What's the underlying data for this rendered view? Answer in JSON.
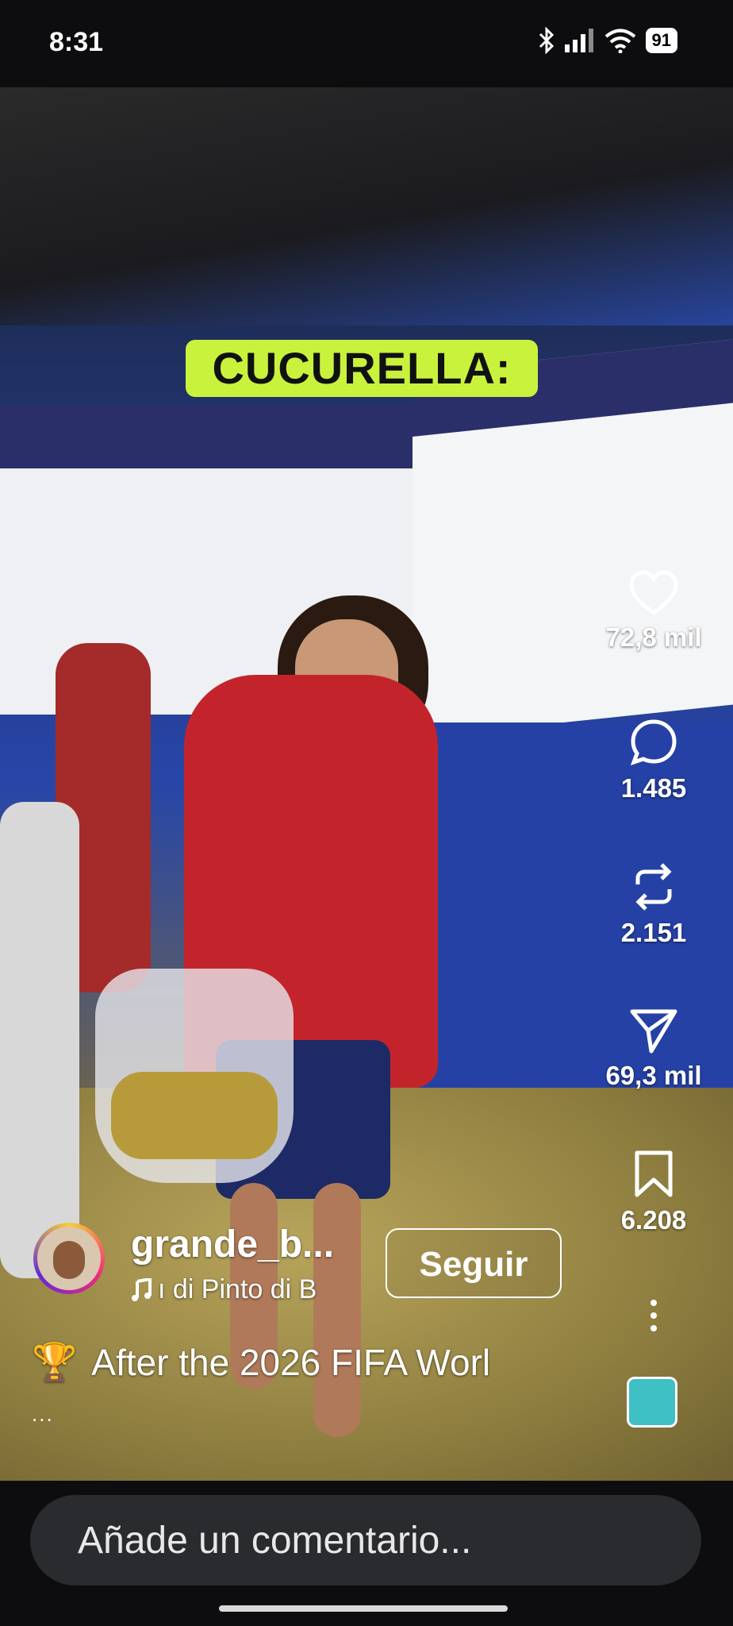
{
  "status_bar": {
    "time": "8:31",
    "battery": "91"
  },
  "video": {
    "overlay_caption": "CUCURELLA:"
  },
  "actions": {
    "likes": "72,8 mil",
    "comments": "1.485",
    "reposts": "2.151",
    "shares": "69,3 mil",
    "saves": "6.208"
  },
  "author": {
    "username": "grande_b...",
    "audio": "ı di Pinto di B",
    "follow_label": "Seguir"
  },
  "description": {
    "emoji": "🏆",
    "text": "After the 2026 FIFA Worl",
    "more": "..."
  },
  "comment_box": {
    "placeholder": "Añade un comentario..."
  }
}
